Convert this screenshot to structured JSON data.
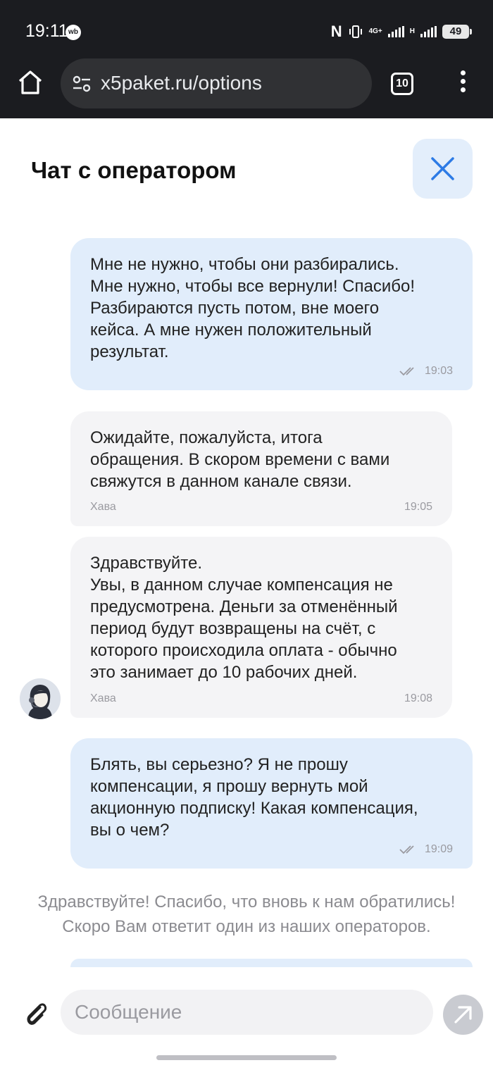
{
  "status_bar": {
    "time": "19:11",
    "app_badge": "wb",
    "network_1": "4G+",
    "network_2": "H",
    "battery": "49"
  },
  "browser": {
    "url": "x5paket.ru/options",
    "tab_count": "10"
  },
  "chat": {
    "title": "Чат с оператором",
    "messages": [
      {
        "direction": "outgoing",
        "text": "Мне не нужно, чтобы они разбирались.\nМне нужно, чтобы все вернули! Спасибо!\nРазбираются пусть потом, вне моего\nкейса. А мне нужен положительный\nрезультат.",
        "time": "19:03"
      },
      {
        "direction": "incoming",
        "text": "Ожидайте, пожалуйста, итога\nобращения. В скором времени с вами\nсвяжутся в данном канале связи.",
        "sender": "Хава",
        "time": "19:05"
      },
      {
        "direction": "incoming",
        "text": "Здравствуйте.\nУвы, в данном случае компенсация не\nпредусмотрена. Деньги за отменённый\nпериод будут возвращены на счёт, с\nкоторого происходила оплата - обычно\nэто занимает до 10 рабочих дней.",
        "sender": "Хава",
        "time": "19:08"
      },
      {
        "direction": "outgoing",
        "text": "Блять, вы серьезно? Я не прошу\nкомпенсации, я прошу вернуть мой\nакционную подписку! Какая компенсация,\nвы о чем?",
        "time": "19:09"
      }
    ],
    "system_note": "Здравствуйте! Спасибо, что вновь к нам обратились!\nСкоро Вам ответит один из наших операторов."
  },
  "composer": {
    "placeholder": "Сообщение"
  },
  "colors": {
    "outgoing_bubble": "#e1edfb",
    "incoming_bubble": "#f4f4f6",
    "close_accent": "#2d7be5"
  }
}
